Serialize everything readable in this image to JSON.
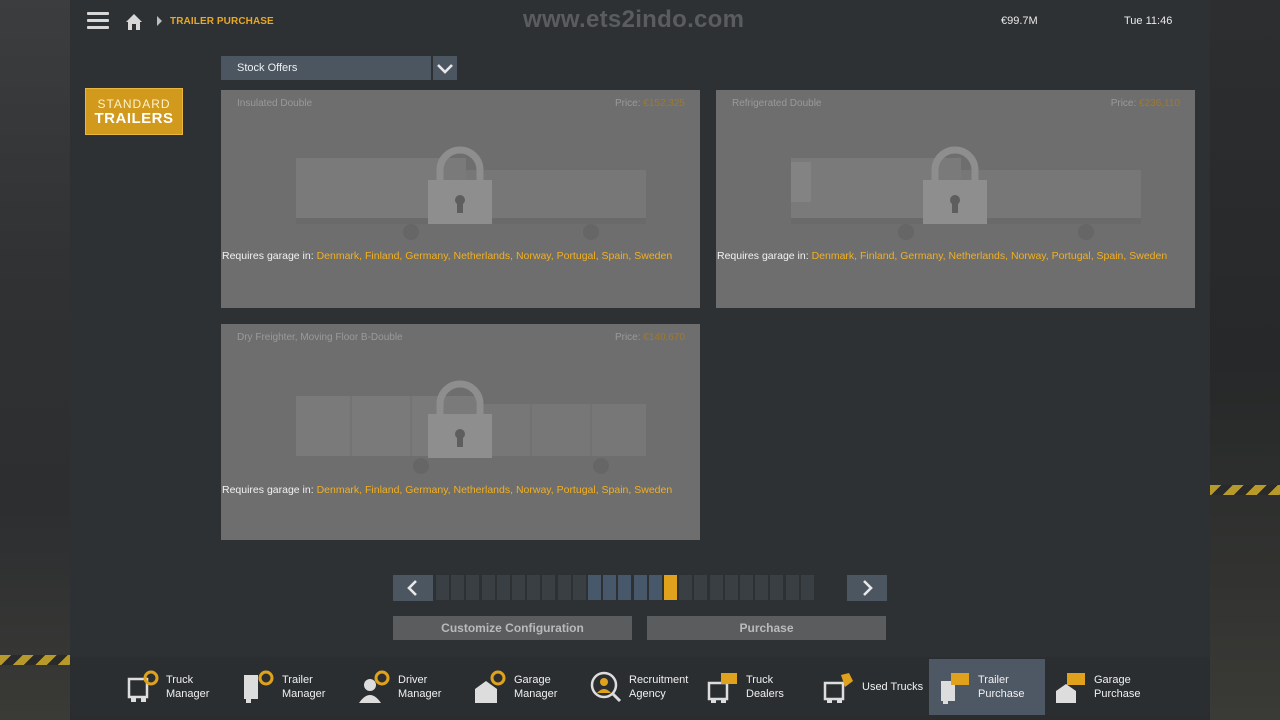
{
  "header": {
    "breadcrumb": "TRAILER PURCHASE",
    "watermark": "www.ets2indo.com",
    "money": "€99.7M",
    "clock": "Tue 11:46"
  },
  "badge": {
    "line1": "STANDARD",
    "line2": "TRAILERS"
  },
  "filter": {
    "selected": "Stock Offers"
  },
  "offers": [
    {
      "name": "Insulated Double",
      "price_label": "Price:",
      "price": "€152,325",
      "requires": "Requires garage in:",
      "countries": "Denmark, Finland, Germany, Netherlands, Norway, Portugal, Spain, Sweden"
    },
    {
      "name": "Refrigerated Double",
      "price_label": "Price:",
      "price": "€236,110",
      "requires": "Requires garage in:",
      "countries": "Denmark, Finland, Germany, Netherlands, Norway, Portugal, Spain, Sweden"
    },
    {
      "name": "Dry Freighter, Moving Floor B-Double",
      "price_label": "Price:",
      "price": "€140,670",
      "requires": "Requires garage in:",
      "countries": "Denmark, Finland, Germany, Netherlands, Norway, Portugal, Spain, Sweden"
    }
  ],
  "pagination": {
    "total_pages": 25,
    "visible_pages": [
      11,
      12,
      13,
      14,
      15
    ],
    "current_page": 16
  },
  "actions": {
    "customize": "Customize Configuration",
    "purchase": "Purchase"
  },
  "bottom_nav": [
    {
      "label1": "Truck",
      "label2": "Manager",
      "icon": "truck-gear-icon"
    },
    {
      "label1": "Trailer",
      "label2": "Manager",
      "icon": "trailer-gear-icon"
    },
    {
      "label1": "Driver",
      "label2": "Manager",
      "icon": "driver-gear-icon"
    },
    {
      "label1": "Garage",
      "label2": "Manager",
      "icon": "garage-gear-icon"
    },
    {
      "label1": "Recruitment",
      "label2": "Agency",
      "icon": "recruitment-icon"
    },
    {
      "label1": "Truck",
      "label2": "Dealers",
      "icon": "truck-card-icon"
    },
    {
      "label1": "Used Trucks",
      "label2": "",
      "icon": "used-truck-tag-icon"
    },
    {
      "label1": "Trailer",
      "label2": "Purchase",
      "icon": "trailer-card-icon",
      "active": true
    },
    {
      "label1": "Garage",
      "label2": "Purchase",
      "icon": "garage-card-icon"
    }
  ],
  "colors": {
    "accent": "#e0a21c",
    "panel": "#2e3134",
    "button": "#4c5660",
    "active_nav": "#4e5864"
  }
}
